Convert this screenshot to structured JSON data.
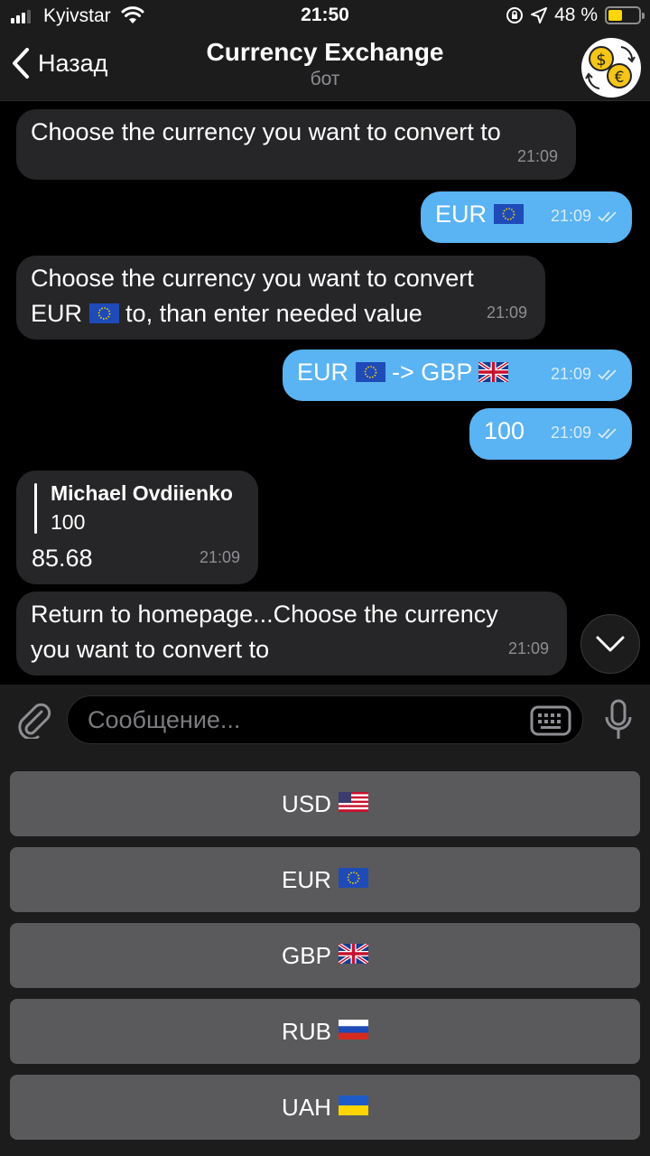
{
  "status_bar": {
    "carrier": "Kyivstar",
    "time": "21:50",
    "battery": "48 %",
    "battery_level": 0.48,
    "battery_color": "#ffd60a"
  },
  "header": {
    "back_label": "Назад",
    "title": "Currency Exchange",
    "subtitle": "бот",
    "avatar_icon": "currency-exchange-icon"
  },
  "messages": [
    {
      "direction": "incoming",
      "text": "Choose the currency you want to convert to",
      "time": "21:09"
    },
    {
      "direction": "outgoing",
      "text": "EUR",
      "flag": "eu",
      "time": "21:09",
      "read": true
    },
    {
      "direction": "incoming",
      "line1": "Choose the currency you want to convert",
      "line2_a": "EUR",
      "flag": "eu",
      "line2_b": "to, than enter needed value",
      "time": "21:09"
    },
    {
      "direction": "outgoing",
      "text_a": "EUR",
      "flag_a": "eu",
      "text_b": "-> GBP",
      "flag_b": "gb",
      "time": "21:09",
      "read": true
    },
    {
      "direction": "outgoing",
      "text": "100",
      "time": "21:09",
      "read": true
    },
    {
      "direction": "incoming",
      "reply_name": "Michael Ovdiienko",
      "reply_text": "100",
      "text": "85.68",
      "time": "21:09"
    },
    {
      "direction": "incoming",
      "line1": "Return to homepage...Choose the currency",
      "line2": "you want to convert to",
      "time": "21:09"
    }
  ],
  "input": {
    "placeholder": "Сообщение...",
    "value": ""
  },
  "keyboard": {
    "buttons": [
      {
        "label": "USD",
        "flag": "us"
      },
      {
        "label": "EUR",
        "flag": "eu"
      },
      {
        "label": "GBP",
        "flag": "gb"
      },
      {
        "label": "RUB",
        "flag": "ru"
      },
      {
        "label": "UAH",
        "flag": "ua"
      }
    ]
  },
  "colors": {
    "outgoing_bubble": "#5ab3f3",
    "incoming_bubble": "#262628",
    "keyboard_button": "#5a5a5c"
  }
}
